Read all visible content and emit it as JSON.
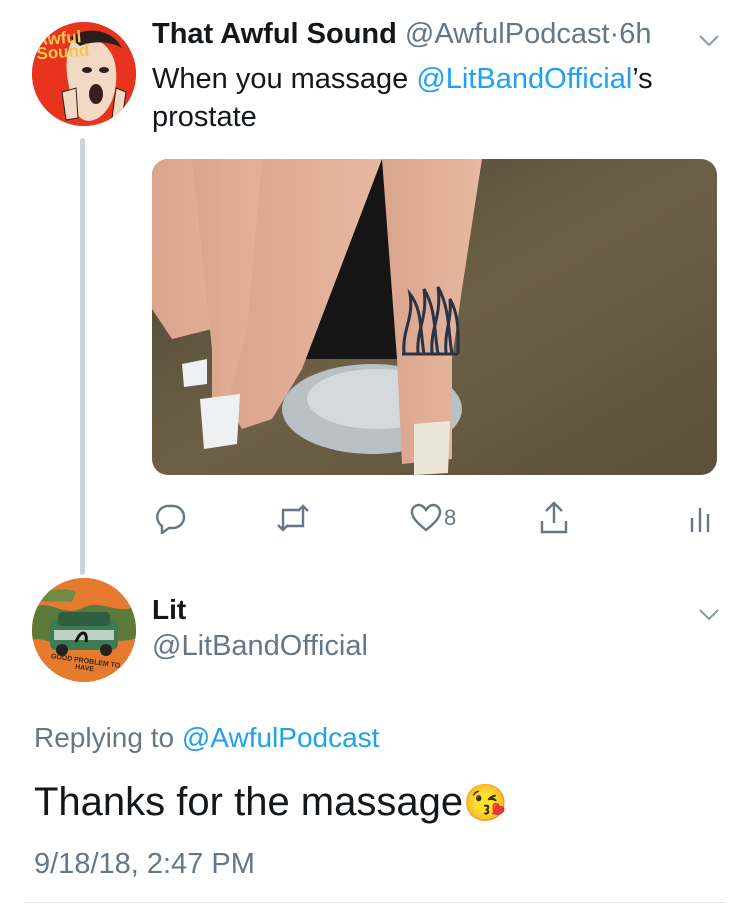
{
  "tweet1": {
    "author_name": "That Awful Sound",
    "author_handle": "@AwfulPodcast",
    "separator": "·",
    "time_ago": "6h",
    "text_before": "When you massage ",
    "mention": "@LitBandOfficial",
    "text_after": "’s prostate",
    "avatar_text": "Awful Sound",
    "actions": {
      "like_count": "8"
    }
  },
  "tweet2": {
    "author_name": "Lit",
    "author_handle": "@LitBandOfficial",
    "avatar_text": "GOOD PROBLEM TO HAVE",
    "replying_prefix": "Replying to ",
    "replying_handle": "@AwfulPodcast",
    "text": "Thanks for the massage",
    "emoji": "😘",
    "timestamp": "9/18/18, 2:47 PM"
  },
  "colors": {
    "link": "#1da1f2",
    "muted": "#657786",
    "thread_line": "#c8d3db",
    "avatar1_bg": "#e8341f",
    "avatar2_bg": "#e67a2f"
  },
  "icons": {
    "reply": "reply-icon",
    "retweet": "retweet-icon",
    "like": "heart-icon",
    "share": "share-icon",
    "analytics": "analytics-icon",
    "caret": "chevron-down-icon"
  }
}
